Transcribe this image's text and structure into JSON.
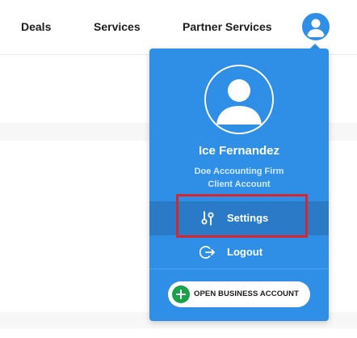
{
  "nav": {
    "links": [
      {
        "label": "Deals"
      },
      {
        "label": "Services"
      },
      {
        "label": "Partner Services"
      }
    ],
    "avatar_icon": "user-avatar-icon"
  },
  "dropdown": {
    "user_name": "Ice Fernandez",
    "company": "Doe Accounting Firm",
    "account_type": "Client Account",
    "menu": [
      {
        "label": "Settings",
        "icon": "settings-sliders-icon",
        "active": true
      },
      {
        "label": "Logout",
        "icon": "logout-arrow-icon",
        "active": false
      }
    ],
    "open_business_button": "OPEN BUSINESS ACCOUNT"
  },
  "colors": {
    "dropdown_bg": "#2f8fe6",
    "active_item_bg": "#2a7ac8",
    "highlight_border": "#d8262d",
    "plus_green": "#1aa14a"
  }
}
